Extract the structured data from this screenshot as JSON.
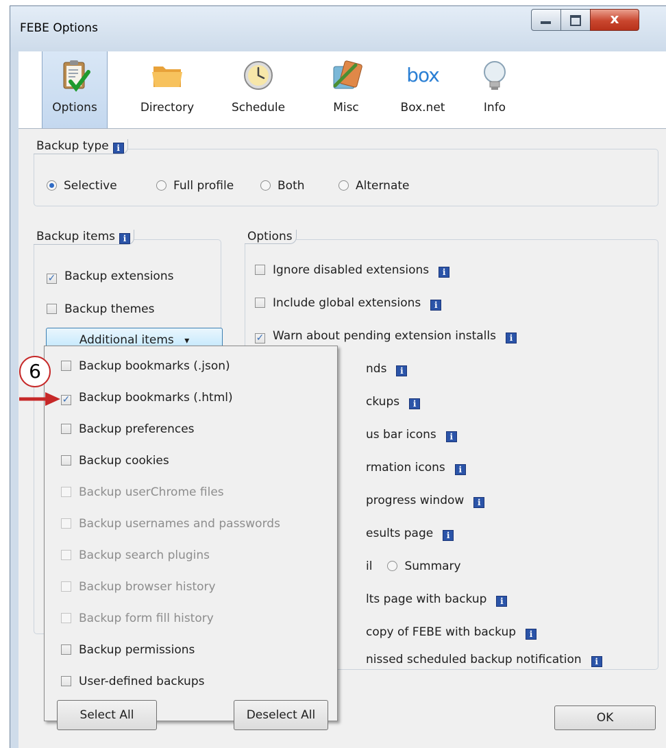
{
  "window": {
    "title": "FEBE Options",
    "min_glyph": "–",
    "max_glyph": "□",
    "close_glyph": "x"
  },
  "toolbar": {
    "items": [
      {
        "label": "Options",
        "icon": "clipboard-check-icon"
      },
      {
        "label": "Directory",
        "icon": "folder-icon"
      },
      {
        "label": "Schedule",
        "icon": "clock-icon"
      },
      {
        "label": "Misc",
        "icon": "tools-icon"
      },
      {
        "label": "Box.net",
        "icon": "box-logo-icon",
        "icon_text": "box"
      },
      {
        "label": "Info",
        "icon": "lightbulb-icon"
      }
    ],
    "selected": "Options"
  },
  "info_glyph": "i",
  "backup_type": {
    "legend": "Backup type",
    "options": [
      "Selective",
      "Full profile",
      "Both",
      "Alternate"
    ],
    "selected": "Selective"
  },
  "backup_items": {
    "legend": "Backup items",
    "extensions": {
      "label": "Backup extensions",
      "checked": true
    },
    "themes": {
      "label": "Backup themes",
      "checked": false
    },
    "additional_button": "Additional items",
    "dropdown_arrow": "▾"
  },
  "options": {
    "legend": "Options",
    "rows": [
      {
        "text": "Ignore disabled extensions",
        "checked": false
      },
      {
        "text": "Include global extensions",
        "checked": false
      },
      {
        "text": "Warn about pending extension installs",
        "checked": true
      },
      {
        "text": "nds"
      },
      {
        "text": "ckups"
      },
      {
        "text": "us bar icons"
      },
      {
        "text": "rmation icons"
      },
      {
        "text": "progress window"
      },
      {
        "text": "esults page"
      },
      {
        "text_left": "il",
        "radio_label": "Summary"
      },
      {
        "text": "lts page with backup"
      },
      {
        "text": "copy of FEBE with backup"
      },
      {
        "text": "nissed scheduled backup notification"
      }
    ]
  },
  "popup": {
    "items": [
      {
        "label": "Backup bookmarks (.json)",
        "checked": false,
        "enabled": true
      },
      {
        "label": "Backup bookmarks (.html)",
        "checked": true,
        "enabled": true
      },
      {
        "label": "Backup preferences",
        "checked": false,
        "enabled": true
      },
      {
        "label": "Backup cookies",
        "checked": false,
        "enabled": true
      },
      {
        "label": "Backup userChrome files",
        "checked": false,
        "enabled": false
      },
      {
        "label": "Backup usernames and passwords",
        "checked": false,
        "enabled": false
      },
      {
        "label": "Backup search plugins",
        "checked": false,
        "enabled": false
      },
      {
        "label": "Backup browser history",
        "checked": false,
        "enabled": false
      },
      {
        "label": "Backup form fill history",
        "checked": false,
        "enabled": false
      },
      {
        "label": "Backup permissions",
        "checked": false,
        "enabled": true
      },
      {
        "label": "User-defined backups",
        "checked": false,
        "enabled": true
      }
    ],
    "select_all": "Select All",
    "deselect_all": "Deselect All"
  },
  "ok_label": "OK",
  "annotation": {
    "number": "6",
    "color": "#c62828"
  },
  "colors": {
    "accent": "#2f6bc5",
    "info_icon": "#2b54a8",
    "titlebar": "#cddbea",
    "close": "#c9462e"
  }
}
